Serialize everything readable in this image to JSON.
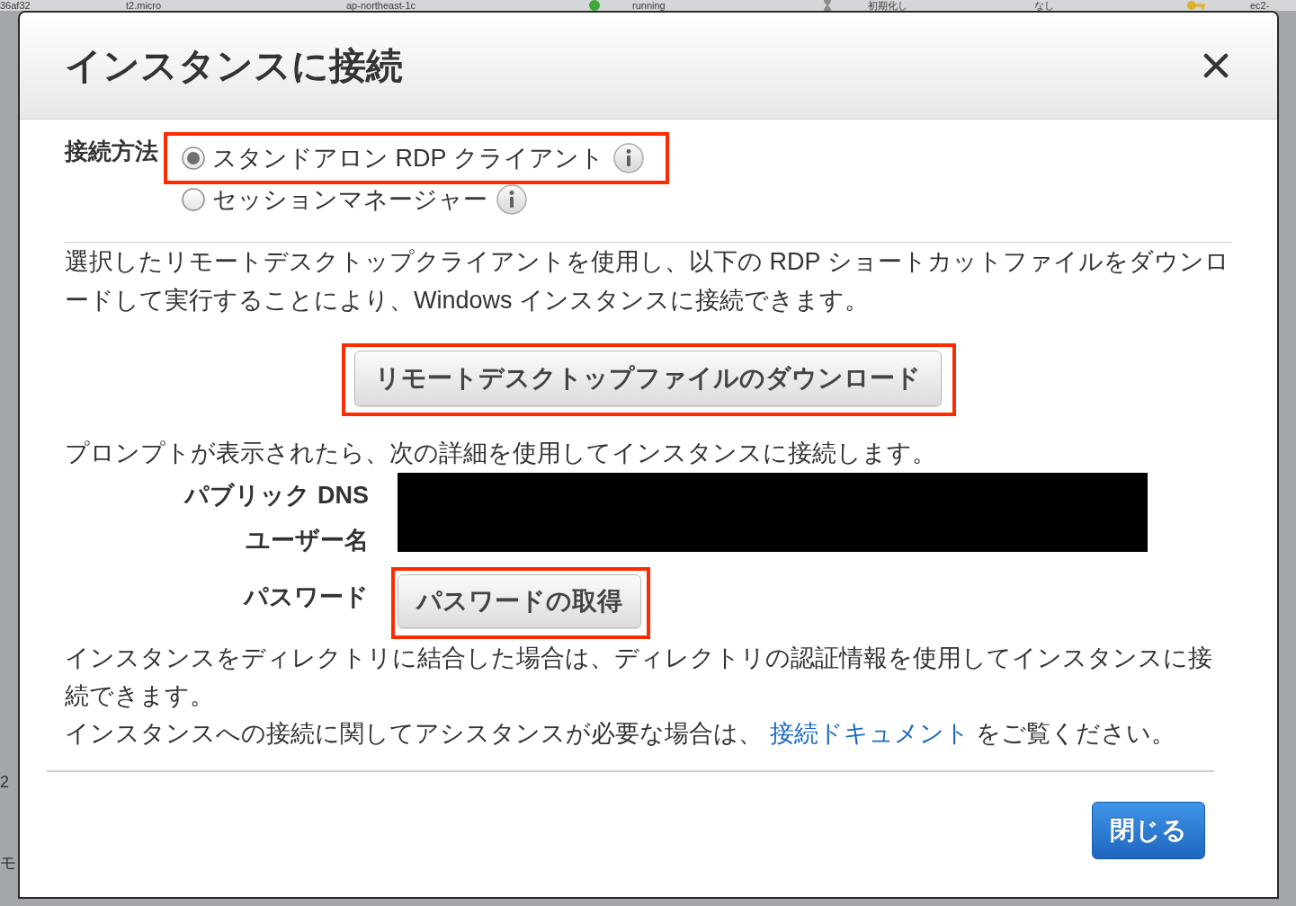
{
  "background_table": {
    "row": [
      {
        "kind": "text",
        "text": "36af32"
      },
      {
        "kind": "text",
        "text": "t2.micro"
      },
      {
        "kind": "text",
        "text": "ap-northeast-1c"
      },
      {
        "kind": "dot",
        "text": "running",
        "color": "#3aa935"
      },
      {
        "kind": "pending",
        "text": "初期化し"
      },
      {
        "kind": "text",
        "text": "なし"
      },
      {
        "kind": "key",
        "text": "ec2-"
      }
    ],
    "side_fragments": [
      "2",
      "モ"
    ]
  },
  "dialog": {
    "title": "インスタンスに接続",
    "method": {
      "label": "接続方法",
      "options": [
        {
          "label": "スタンドアロン RDP クライアント",
          "selected": true,
          "highlighted": true
        },
        {
          "label": "セッションマネージャー",
          "selected": false,
          "highlighted": false
        }
      ]
    },
    "description": "選択したリモートデスクトップクライアントを使用し、以下の RDP ショートカットファイルをダウンロードして実行することにより、Windows インスタンスに接続できます。",
    "download_button": {
      "label": "リモートデスクトップファイルのダウンロード",
      "highlighted": true
    },
    "prompt": "プロンプトが表示されたら、次の詳細を使用してインスタンスに接続します。",
    "details": [
      {
        "label": "パブリック DNS",
        "kind": "redacted"
      },
      {
        "label": "ユーザー名",
        "kind": "redacted"
      },
      {
        "label": "パスワード",
        "kind": "button",
        "button_label": "パスワードの取得",
        "highlighted": true
      }
    ],
    "directory_note": "インスタンスをディレクトリに結合した場合は、ディレクトリの認証情報を使用してインスタンスに接続できます。",
    "help": {
      "before": "インスタンスへの接続に関してアシスタンスが必要な場合は、",
      "link": "接続ドキュメント",
      "after": "をご覧ください。"
    },
    "close_button": "閉じる"
  }
}
